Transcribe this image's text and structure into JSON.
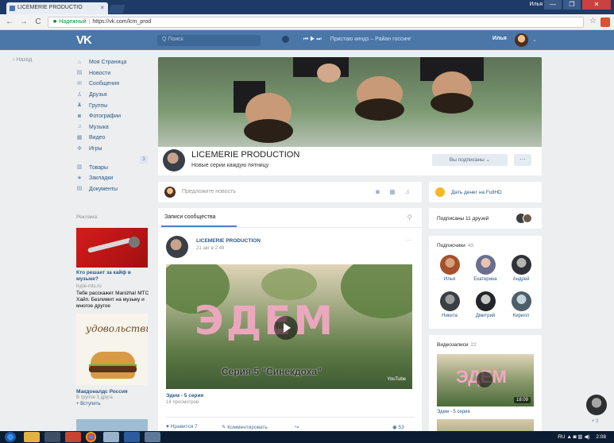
{
  "browser": {
    "tab_title": "LICEMERIE PRODUCTIO",
    "tab_close": "×",
    "window_user": "Илья",
    "win_buttons": [
      "—",
      "❐",
      "✕"
    ],
    "nav": {
      "back": "←",
      "forward": "→",
      "reload": "C"
    },
    "address": {
      "secure_label": "Надежный",
      "url": "https://vk.com/lcm_prod"
    },
    "star": "☆"
  },
  "vk_header": {
    "logo": "VK",
    "search_placeholder": "Q  Поиск",
    "player_controls": "⏮  ▶  ⏭",
    "now_playing": "Пристаю киндз – Райан госсинг",
    "user_name": "Илья",
    "user_caret": "⌄"
  },
  "back_link": "‹  Назад",
  "left_menu": {
    "items": [
      {
        "icon": "⌂",
        "label": "Моя Страница"
      },
      {
        "icon": "▤",
        "label": "Новости"
      },
      {
        "icon": "✉",
        "label": "Сообщения"
      },
      {
        "icon": "♙",
        "label": "Друзья"
      },
      {
        "icon": "♟",
        "label": "Группы"
      },
      {
        "icon": "◙",
        "label": "Фотографии"
      },
      {
        "icon": "♫",
        "label": "Музыка"
      },
      {
        "icon": "▦",
        "label": "Видео"
      },
      {
        "icon": "✜",
        "label": "Игры"
      }
    ],
    "games_badge": "3",
    "items2": [
      {
        "icon": "▥",
        "label": "Товары"
      },
      {
        "icon": "★",
        "label": "Закладки"
      },
      {
        "icon": "▤",
        "label": "Документы"
      }
    ]
  },
  "ads": {
    "label": "Реклама",
    "ad1": {
      "title": "Кто решает за кайф в музыке?",
      "domain": "hype-mts.ru",
      "text": "Тебе расскажет Manizha! МТС Хайп. Безлимит на музыку и многое другое"
    },
    "ad2": {
      "script": "удовольствия",
      "title": "Макдоналдс Россия",
      "sub": "В группе 3 друга",
      "join": "+ Вступить"
    }
  },
  "group": {
    "name": "LICEMERIE PRODUCTION",
    "status": "Новые серии каждую пятницу",
    "subscribed_label": "Вы подписаны ⌄",
    "more_label": "···"
  },
  "suggest": {
    "placeholder": "Предложите новость",
    "tools": "◙ ▦ ♫"
  },
  "wall": {
    "tab_label": "Записи сообщества",
    "search_icon": "⚲",
    "post": {
      "author": "LICEMERIE PRODUCTION",
      "date": "21 авг в 2:48",
      "more": "···",
      "video": {
        "title_overlay": "ЭДЕМ",
        "subtitle": "Серия 5 \"Синекдоха\"",
        "yt": "YouTube",
        "title": "Эдем - 5 серия",
        "views": "14 просмотров"
      },
      "actions": {
        "like": "♥  Нравится  7",
        "comment": "✎  Комментировать",
        "share": "↪",
        "views": "◉  53"
      }
    }
  },
  "right": {
    "fundraise": "Дать денег на FullHD",
    "friends_subscribed": "Подписаны 11 друзей",
    "followers": {
      "title": "Подписчики",
      "count": "43",
      "people": [
        {
          "name": "Илья",
          "color": "#a5512b"
        },
        {
          "name": "Екатерина",
          "color": "#6b6f8f"
        },
        {
          "name": "Андрей",
          "color": "#2f3236"
        },
        {
          "name": "Никита",
          "color": "#3b3f44"
        },
        {
          "name": "Дмитрий",
          "color": "#24252a"
        },
        {
          "name": "Кирилл",
          "color": "#4d5e6b"
        }
      ]
    },
    "videos": {
      "title": "Видеозаписи",
      "count": "22",
      "thumb_title": "ЭДЕМ",
      "duration": "18:09",
      "caption": "Эдем - 5 серия"
    }
  },
  "floating": {
    "badge": "+ 2"
  },
  "taskbar": {
    "lang": "RU",
    "tray_icons": "▲ ◙ ▥ ◀)",
    "clock": "2:08"
  },
  "colors": {
    "vk_blue": "#4a76a8",
    "link": "#2a5885",
    "page_bg": "#edeef0"
  }
}
